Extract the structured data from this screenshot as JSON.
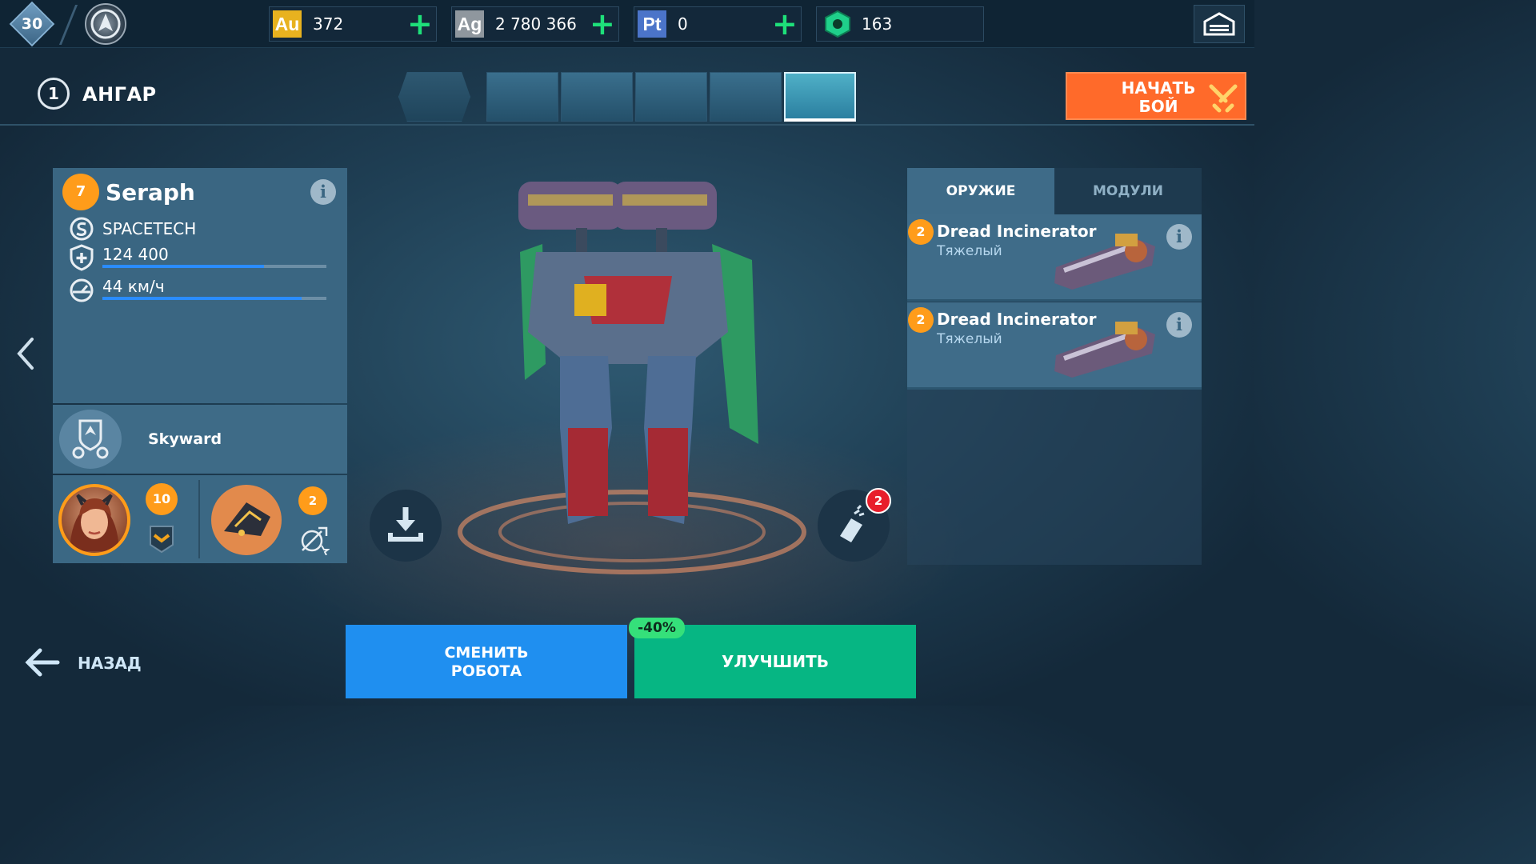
{
  "topbar": {
    "player_level": "30",
    "currencies": [
      {
        "code": "Au",
        "value": "372",
        "color": "#e8b21f"
      },
      {
        "code": "Ag",
        "value": "2 780 366",
        "color": "#9da4aa"
      },
      {
        "code": "Pt",
        "value": "0",
        "color": "#4b74c9"
      },
      {
        "code": "keys",
        "value": "163",
        "color": "#1fd08a"
      }
    ],
    "icons": {
      "rank": "rank-emblem-icon",
      "garage": "garage-icon",
      "plus": "plus-icon"
    }
  },
  "header": {
    "hangar_number": "1",
    "hangar_title": "АНГАР",
    "robot_thumbs": [
      "robot-1",
      "robot-2",
      "robot-3",
      "robot-4",
      "robot-5",
      "robot-6"
    ],
    "selected_thumb": 5,
    "start_battle_label": "НАЧАТЬ\nБОЙ"
  },
  "robot": {
    "level": "7",
    "name": "Seraph",
    "manufacturer": "SPACETECH",
    "health": "124 400",
    "health_fraction": 0.72,
    "speed": "44 км/ч",
    "speed_fraction": 0.89,
    "ability": "Skyward"
  },
  "pilot": {
    "level": "10"
  },
  "drone": {
    "level": "2"
  },
  "paint": {
    "badge": "2"
  },
  "equipment": {
    "tabs": [
      {
        "label": "ОРУЖИЕ",
        "active": true
      },
      {
        "label": "МОДУЛИ",
        "active": false
      }
    ],
    "weapons": [
      {
        "level": "2",
        "name": "Dread Incinerator",
        "class": "Тяжелый"
      },
      {
        "level": "2",
        "name": "Dread Incinerator",
        "class": "Тяжелый"
      }
    ]
  },
  "footer": {
    "back_label": "НАЗАД",
    "swap_label": "СМЕНИТЬ\nРОБОТА",
    "upgrade_label": "УЛУЧШИТЬ",
    "discount": "-40%"
  },
  "colors": {
    "accent_orange": "#ff9c1a",
    "start_battle": "#ff6a2a",
    "swap_button": "#1f8ff0",
    "upgrade_button": "#06b683",
    "discount_badge": "#35e07a",
    "notification": "#e81d2b"
  }
}
